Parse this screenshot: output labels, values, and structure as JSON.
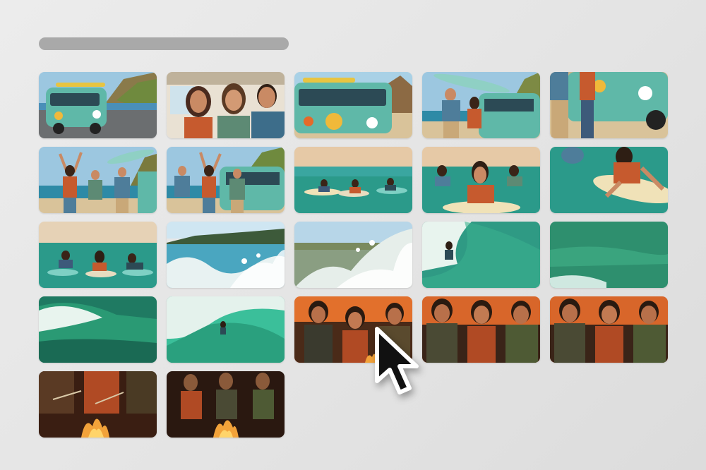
{
  "thumbnails": [
    {
      "scene": "van-road",
      "selected": false
    },
    {
      "scene": "van-interior-friends",
      "selected": false
    },
    {
      "scene": "van-beach",
      "selected": false
    },
    {
      "scene": "surfboard-van",
      "selected": false
    },
    {
      "scene": "van-closeup",
      "selected": false
    },
    {
      "scene": "cheering-beach",
      "selected": false
    },
    {
      "scene": "cheering-van",
      "selected": false
    },
    {
      "scene": "paddling-wide",
      "selected": false
    },
    {
      "scene": "paddling-close",
      "selected": false
    },
    {
      "scene": "paddling-surfboard",
      "selected": false
    },
    {
      "scene": "paddling-three",
      "selected": false
    },
    {
      "scene": "splash-shore",
      "selected": false
    },
    {
      "scene": "splash-water",
      "selected": false
    },
    {
      "scene": "surfer-wave",
      "selected": false
    },
    {
      "scene": "green-water",
      "selected": false
    },
    {
      "scene": "breaking-wave",
      "selected": false
    },
    {
      "scene": "barrel-surfer",
      "selected": false
    },
    {
      "scene": "campfire-sunset",
      "selected": true
    },
    {
      "scene": "campfire-smiling",
      "selected": false
    },
    {
      "scene": "campfire-smiling-2",
      "selected": false
    },
    {
      "scene": "campfire-marshmallows",
      "selected": false
    },
    {
      "scene": "campfire-night",
      "selected": false
    }
  ],
  "colors": {
    "sky": "#9cc7e0",
    "sea": "#2b9a8a",
    "van": "#5fb8a8",
    "sand": "#d9c39a",
    "sunset": "#e2702c",
    "fire": "#f2a23a"
  }
}
